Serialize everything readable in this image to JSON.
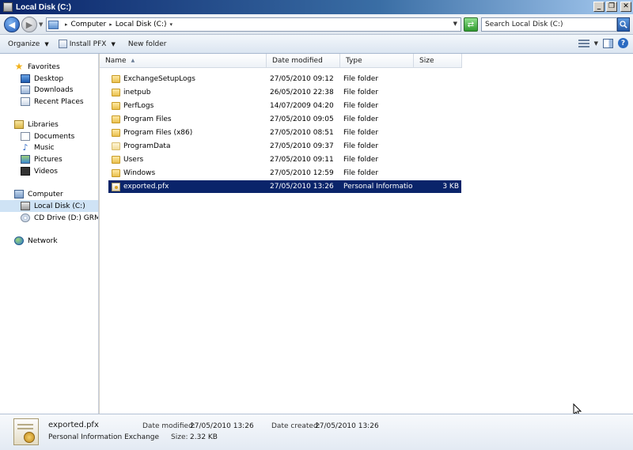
{
  "window": {
    "title": "Local Disk (C:)"
  },
  "address": {
    "crumbs": [
      "Computer",
      "Local Disk (C:)"
    ],
    "search_placeholder": "Search Local Disk (C:)"
  },
  "toolbar": {
    "organize": "Organize",
    "install_pfx": "Install PFX",
    "new_folder": "New folder"
  },
  "navpane": {
    "favorites": {
      "label": "Favorites",
      "items": [
        "Desktop",
        "Downloads",
        "Recent Places"
      ]
    },
    "libraries": {
      "label": "Libraries",
      "items": [
        "Documents",
        "Music",
        "Pictures",
        "Videos"
      ]
    },
    "computer": {
      "label": "Computer",
      "items": [
        "Local Disk (C:)",
        "CD Drive (D:) GRMSXV"
      ]
    },
    "network": {
      "label": "Network"
    }
  },
  "columns": [
    "Name",
    "Date modified",
    "Type",
    "Size"
  ],
  "files": [
    {
      "name": "ExchangeSetupLogs",
      "date": "27/05/2010 09:12",
      "type": "File folder",
      "size": ""
    },
    {
      "name": "inetpub",
      "date": "26/05/2010 22:38",
      "type": "File folder",
      "size": ""
    },
    {
      "name": "PerfLogs",
      "date": "14/07/2009 04:20",
      "type": "File folder",
      "size": ""
    },
    {
      "name": "Program Files",
      "date": "27/05/2010 09:05",
      "type": "File folder",
      "size": ""
    },
    {
      "name": "Program Files (x86)",
      "date": "27/05/2010 08:51",
      "type": "File folder",
      "size": ""
    },
    {
      "name": "ProgramData",
      "date": "27/05/2010 09:37",
      "type": "File folder",
      "size": ""
    },
    {
      "name": "Users",
      "date": "27/05/2010 09:11",
      "type": "File folder",
      "size": ""
    },
    {
      "name": "Windows",
      "date": "27/05/2010 12:59",
      "type": "File folder",
      "size": ""
    },
    {
      "name": "exported.pfx",
      "date": "27/05/2010 13:26",
      "type": "Personal Informatio...",
      "size": "3 KB"
    }
  ],
  "details": {
    "name": "exported.pfx",
    "type": "Personal Information Exchange",
    "date_modified_label": "Date modified:",
    "date_modified": "27/05/2010 13:26",
    "date_created_label": "Date created:",
    "date_created": "27/05/2010 13:26",
    "size_label": "Size:",
    "size": "2.32 KB"
  }
}
